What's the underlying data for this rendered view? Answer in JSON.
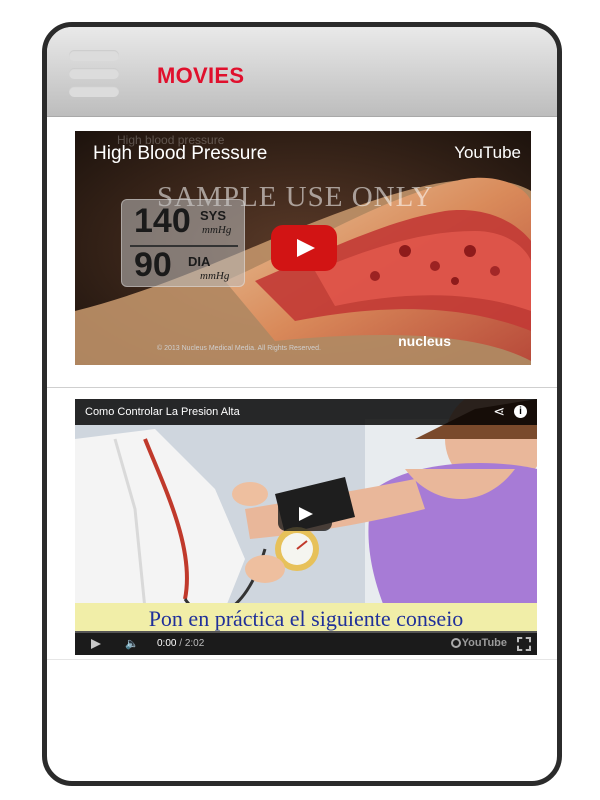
{
  "header": {
    "title": "MOVIES",
    "menu_icon": "hamburger-menu-icon",
    "title_color": "#e0102d"
  },
  "videos": [
    {
      "title": "High Blood Pressure",
      "title_ghost": "High blood pressure",
      "provider": "YouTube",
      "watermark": "SAMPLE USE ONLY",
      "bp_systolic": "140",
      "bp_systolic_label": "SYS",
      "bp_diastolic": "90",
      "bp_diastolic_label": "DIA",
      "bp_unit": "mmHg",
      "copyright": "© 2013 Nucleus Medical Media. All Rights Reserved.",
      "logo": "nucleus",
      "play_icon": "youtube-play-icon"
    },
    {
      "title": "Como Controlar La Presion Alta",
      "caption": "Pon en práctica el siguiente conseio",
      "time_current": "0:00",
      "time_separator": " / ",
      "time_duration": "2:02",
      "yt_logo": "YouTube",
      "share_icon": "share-icon",
      "info_icon": "info-icon",
      "info_glyph": "i",
      "share_glyph": "⋖",
      "volume_glyph": "🔈"
    }
  ],
  "colors": {
    "accent": "#e0102d",
    "yt_red": "#d21414",
    "caption_bg": "#f1eea8",
    "caption_text": "#20309a"
  }
}
